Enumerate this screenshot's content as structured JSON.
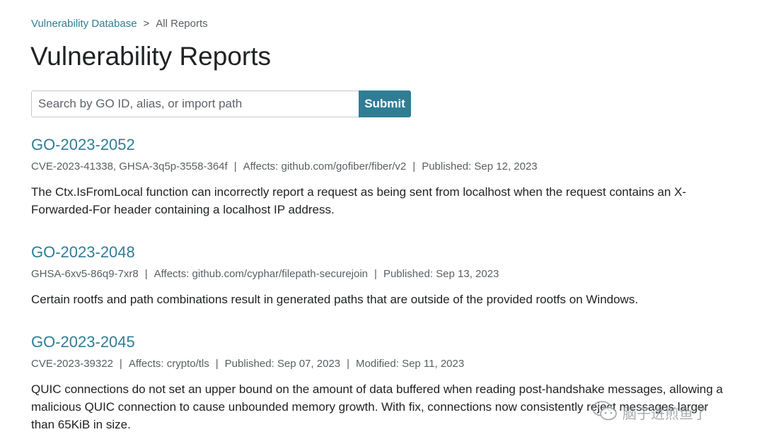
{
  "breadcrumb": {
    "parent": "Vulnerability Database",
    "separator": ">",
    "current": "All Reports"
  },
  "page_title": "Vulnerability Reports",
  "search": {
    "placeholder": "Search by GO ID, alias, or import path",
    "value": "",
    "submit_label": "Submit"
  },
  "reports": [
    {
      "id": "GO-2023-2052",
      "aliases": "CVE-2023-41338, GHSA-3q5p-3558-364f",
      "affects": "Affects: github.com/gofiber/fiber/v2",
      "published": "Published: Sep 12, 2023",
      "description": "The Ctx.IsFromLocal function can incorrectly report a request as being sent from localhost when the request contains an X-Forwarded-For header containing a localhost IP address."
    },
    {
      "id": "GO-2023-2048",
      "aliases": "GHSA-6xv5-86q9-7xr8",
      "affects": "Affects: github.com/cyphar/filepath-securejoin",
      "published": "Published: Sep 13, 2023",
      "description": "Certain rootfs and path combinations result in generated paths that are outside of the provided rootfs on Windows."
    },
    {
      "id": "GO-2023-2045",
      "aliases": "CVE-2023-39322",
      "affects": "Affects: crypto/tls",
      "published": "Published: Sep 07, 2023",
      "modified": "Modified: Sep 11, 2023",
      "description": "QUIC connections do not set an upper bound on the amount of data buffered when reading post-handshake messages, allowing a malicious QUIC connection to cause unbounded memory growth. With fix, connections now consistently reject messages larger than 65KiB in size."
    }
  ],
  "meta_separator": "|",
  "watermark": {
    "text": "脑子进煎鱼了",
    "icon": "wechat-icon"
  },
  "colors": {
    "link": "#2f7d95",
    "submit_bg": "#2f7d95",
    "text": "#202224",
    "meta_text": "#5a5f63"
  }
}
